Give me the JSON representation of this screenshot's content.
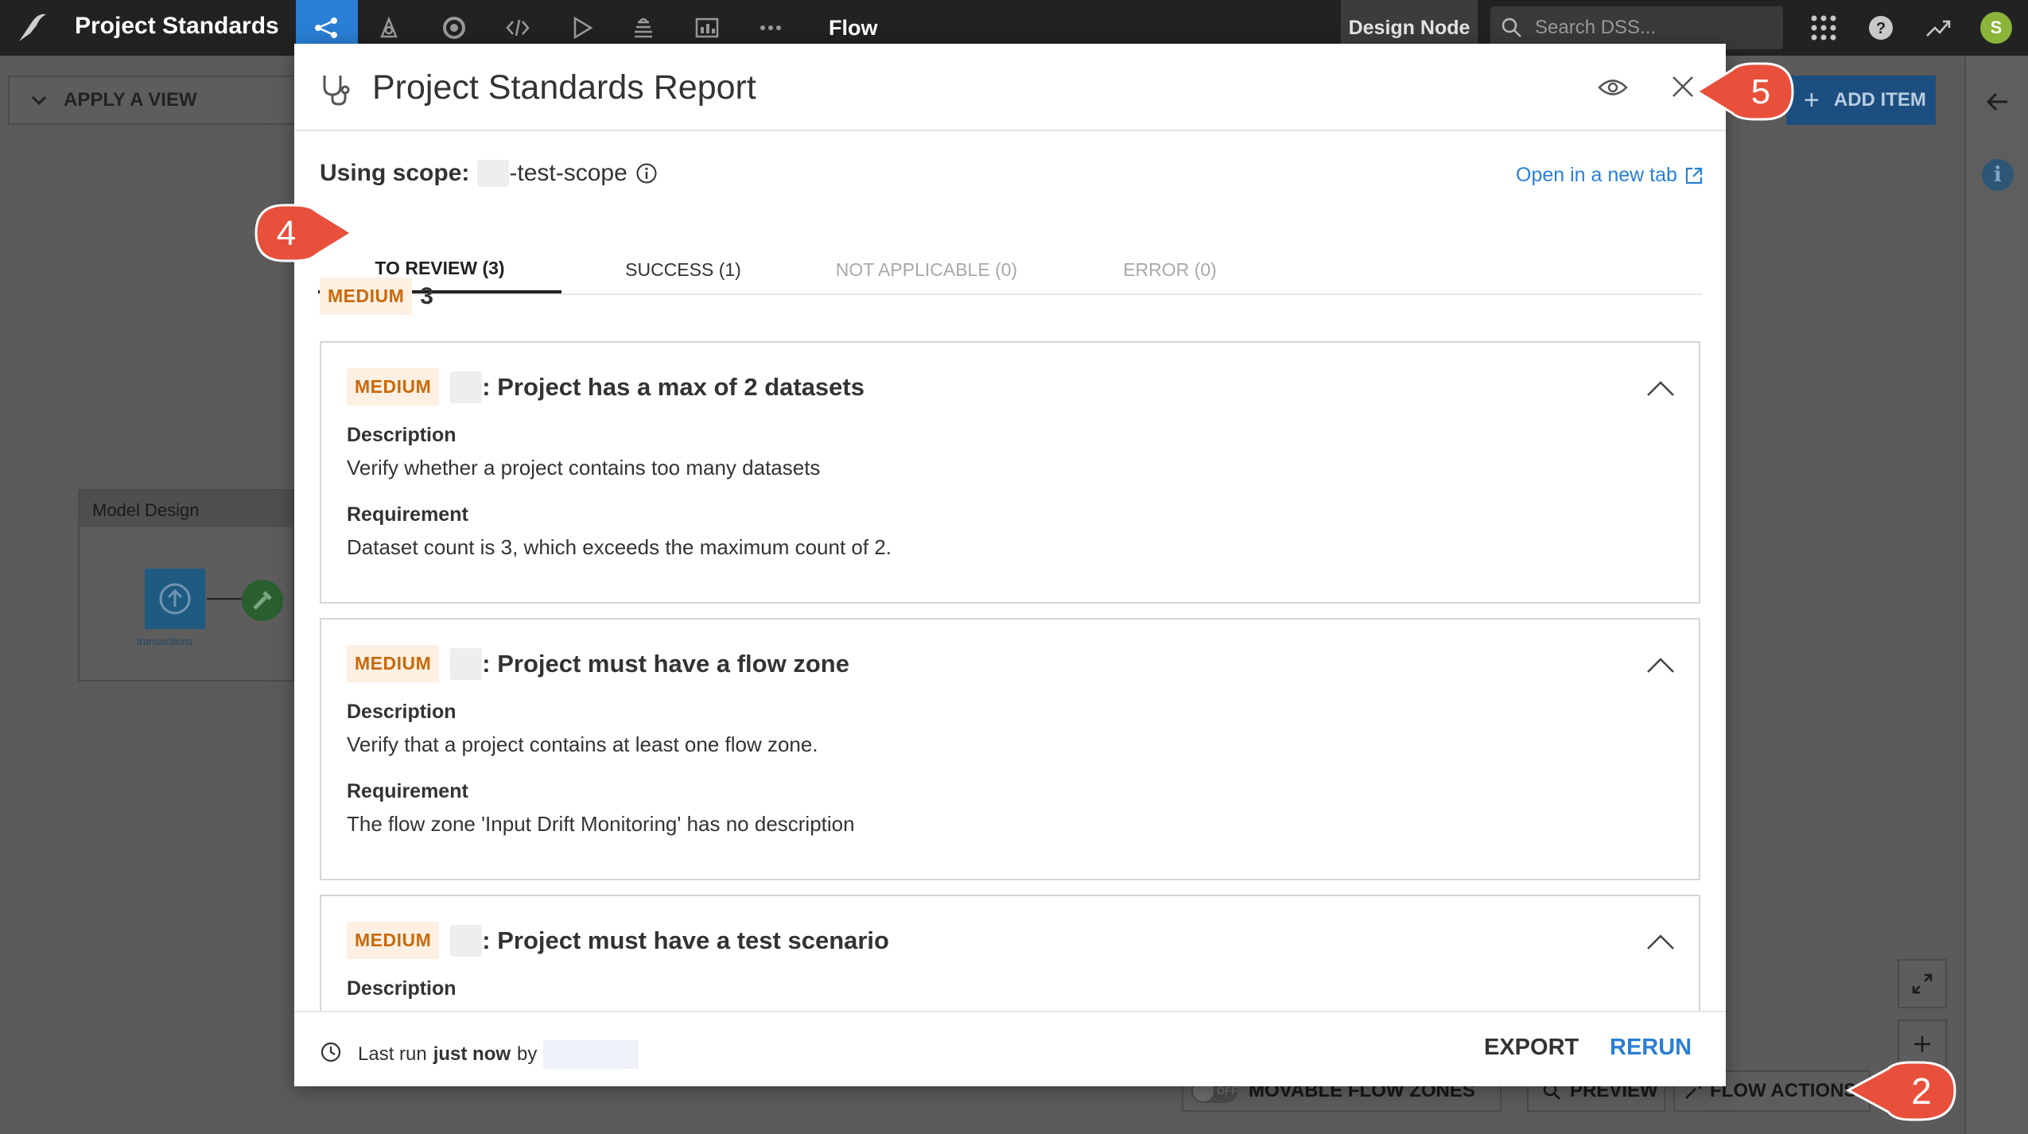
{
  "topbar": {
    "project_name": "Project Standards",
    "flow_label": "Flow",
    "node_label": "Design Node",
    "search_placeholder": "Search DSS...",
    "avatar_initial": "S",
    "nav_icons": [
      "flow-icon",
      "lab-icon",
      "code-icon",
      "code-brackets-icon",
      "play-icon",
      "stack-icon",
      "dashboard-icon",
      "more-icon"
    ]
  },
  "flow": {
    "apply_view_label": "APPLY A VIEW",
    "add_item_label": "ADD ITEM",
    "zone_name": "Model Design",
    "dataset_label": "transactions",
    "toggle_off": "OFF",
    "movable_zones_label": "MOVABLE FLOW ZONES",
    "preview_label": "PREVIEW",
    "flow_actions_label": "FLOW ACTIONS"
  },
  "modal": {
    "title": "Project Standards Report",
    "scope_prefix": "Using scope:",
    "scope_name": "-test-scope",
    "open_new_tab": "Open in a new tab",
    "tabs": [
      {
        "label": "TO REVIEW (3)",
        "state": "active"
      },
      {
        "label": "SUCCESS (1)",
        "state": "normal"
      },
      {
        "label": "NOT APPLICABLE (0)",
        "state": "disabled"
      },
      {
        "label": "ERROR (0)",
        "state": "disabled"
      }
    ],
    "summary": {
      "severity": "MEDIUM",
      "count": "3"
    },
    "checks": [
      {
        "severity": "MEDIUM",
        "title": ": Project has a max of 2 datasets",
        "description_label": "Description",
        "description": "Verify whether a project contains too many datasets",
        "requirement_label": "Requirement",
        "requirement": "Dataset count is 3, which exceeds the maximum count of 2."
      },
      {
        "severity": "MEDIUM",
        "title": ": Project must have a flow zone",
        "description_label": "Description",
        "description": "Verify that a project contains at least one flow zone.",
        "requirement_label": "Requirement",
        "requirement": "The flow zone 'Input Drift Monitoring' has no description"
      },
      {
        "severity": "MEDIUM",
        "title": ": Project must have a test scenario",
        "description_label": "Description"
      }
    ],
    "footer": {
      "last_run_prefix": "Last run",
      "last_run_time": "just now",
      "last_run_by": "by",
      "export_label": "EXPORT",
      "rerun_label": "RERUN"
    }
  },
  "callouts": [
    {
      "number": "5"
    },
    {
      "number": "4"
    },
    {
      "number": "2"
    }
  ],
  "colors": {
    "accent": "#2a7fd4",
    "callout": "#e8503c",
    "medium_badge_bg": "#fdf0e2",
    "medium_badge_text": "#c9690d",
    "topbar": "#222222"
  }
}
